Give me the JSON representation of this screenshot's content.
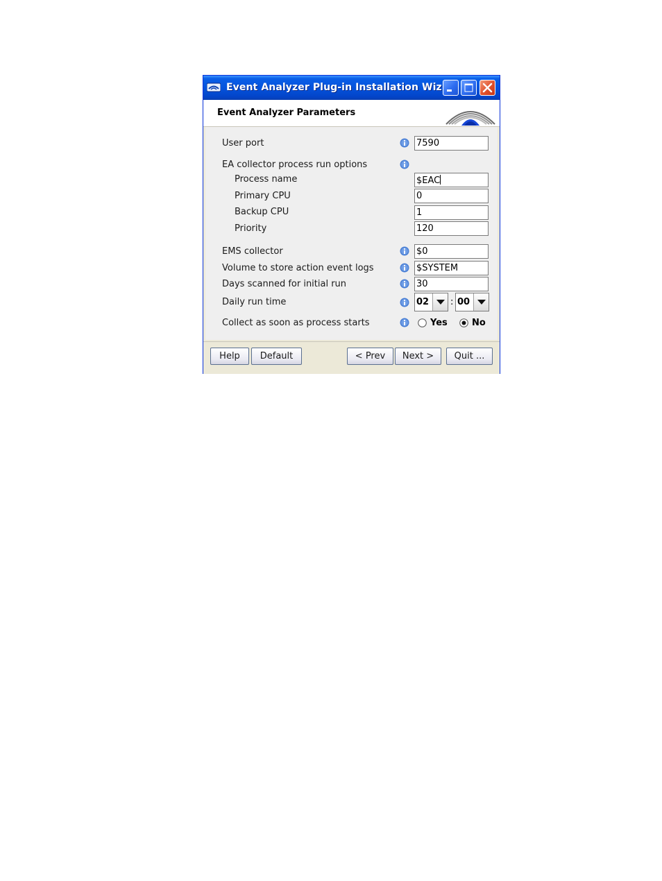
{
  "window": {
    "title": "Event Analyzer Plug-in Installation Wiz...",
    "buttons": {
      "minimize": "minimize-icon",
      "maximize": "maximize-icon",
      "close": "close-icon"
    }
  },
  "header": {
    "title": "Event Analyzer Parameters",
    "logo": "arc-logo"
  },
  "form": {
    "user_port": {
      "label": "User port",
      "value": "7590"
    },
    "collector_options": {
      "label": "EA collector process run options"
    },
    "process_name": {
      "label": "Process name",
      "value": "$EAC"
    },
    "primary_cpu": {
      "label": "Primary CPU",
      "value": "0"
    },
    "backup_cpu": {
      "label": "Backup CPU",
      "value": "1"
    },
    "priority": {
      "label": "Priority",
      "value": "120"
    },
    "ems_collector": {
      "label": "EMS collector",
      "value": "$0"
    },
    "volume": {
      "label": "Volume to store action event logs",
      "value": "$SYSTEM"
    },
    "days_scanned": {
      "label": "Days scanned for initial run",
      "value": "30"
    },
    "daily_run_time": {
      "label": "Daily run time",
      "hour": "02",
      "separator": ":",
      "minute": "00"
    },
    "collect_on_start": {
      "label": "Collect as soon as process starts",
      "yes": "Yes",
      "no": "No",
      "selected": "No"
    }
  },
  "footer": {
    "help": "Help",
    "default": "Default",
    "prev": "< Prev",
    "next": "Next >",
    "quit": "Quit ..."
  },
  "colors": {
    "titlebar": "#0453dc",
    "info_icon": "#4a7fd4",
    "panel": "#efefef",
    "chrome": "#ece9d8"
  }
}
